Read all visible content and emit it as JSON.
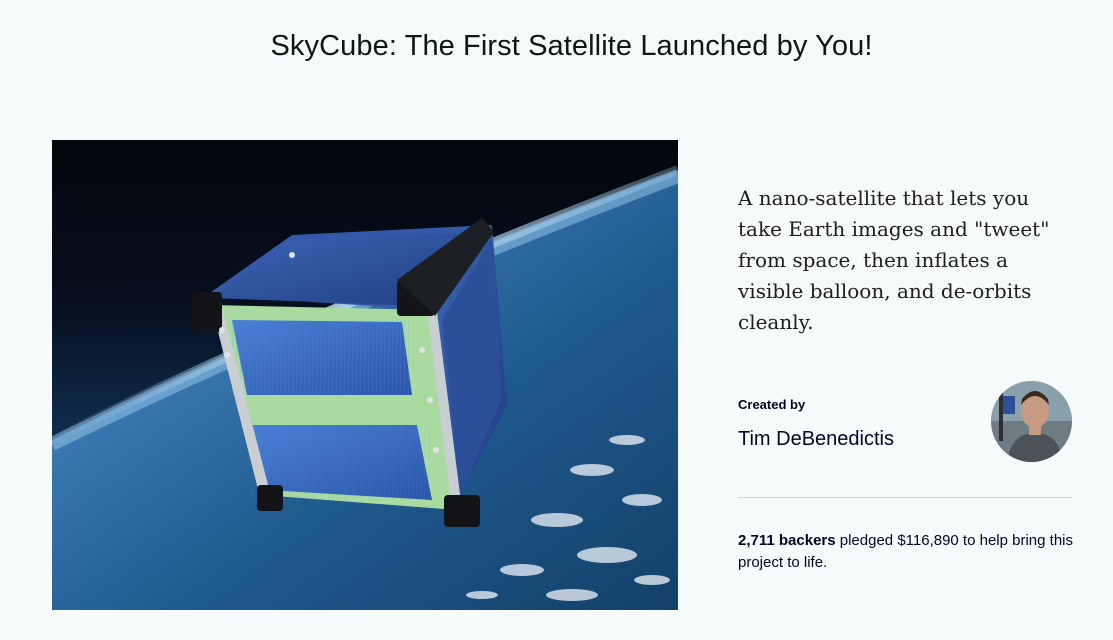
{
  "project": {
    "title": "SkyCube: The First Satellite Launched by You!",
    "blurb": "A nano-satellite that lets you take Earth images and \"tweet\" from space, then inflates a visible balloon, and de-orbits cleanly.",
    "hero_image_alt": "SkyCube satellite in orbit above Earth"
  },
  "creator": {
    "label": "Created by",
    "name": "Tim DeBenedictis",
    "avatar_alt": "Tim DeBenedictis"
  },
  "funding": {
    "backers": "2,711 backers",
    "text": " pledged $116,890 to help bring this project to life."
  },
  "colors": {
    "background": "#f6fafa",
    "text": "#020621",
    "divider": "#d0d4d6"
  }
}
